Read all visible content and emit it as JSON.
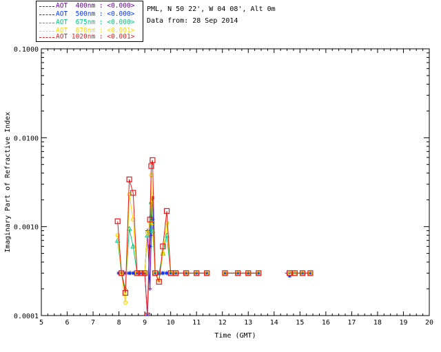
{
  "header": {
    "site": "PML, N 50 22', W 04 08', Alt 0m",
    "date": "Data from: 28 Sep 2014"
  },
  "chart_data": {
    "type": "line",
    "xlabel": "Time (GMT)",
    "ylabel": "Imaginary Part of Refractive Index",
    "xlim": [
      5,
      20
    ],
    "ylim": [
      0.0001,
      0.1
    ],
    "yscale": "log",
    "x_ticks": [
      "5",
      "6",
      "7",
      "8",
      "9",
      "10",
      "11",
      "12",
      "13",
      "14",
      "15",
      "16",
      "17",
      "18",
      "19",
      "20"
    ],
    "y_ticks": [
      "0.0001",
      "0.0010",
      "0.0100",
      "0.1000"
    ],
    "grid": false,
    "legend_position": "top-left",
    "series": [
      {
        "name": "AOT  400nm : <0.000>",
        "color": "#6a00a8",
        "marker": "plus",
        "x": [
          8.0,
          8.15,
          8.3,
          8.45,
          8.6,
          8.75,
          8.9,
          9.0,
          9.1,
          9.2,
          9.25,
          9.3,
          9.4,
          9.55,
          9.7,
          9.85,
          10.0,
          10.2,
          10.5,
          11.0,
          11.4,
          12.1,
          12.6,
          13.0,
          13.4,
          14.5,
          14.7,
          15.1,
          15.4
        ],
        "y": [
          0.0003,
          0.0003,
          0.0003,
          0.0003,
          0.0003,
          0.0003,
          0.0003,
          0.0003,
          0.0009,
          0.0002,
          0.0008,
          0.0012,
          0.0003,
          0.0003,
          0.0003,
          0.0003,
          0.0003,
          0.0003,
          0.0003,
          0.0003,
          0.0003,
          0.0003,
          0.0003,
          0.0003,
          0.0003,
          0.0003,
          0.0003,
          0.0003,
          0.0003
        ]
      },
      {
        "name": "AOT  500nm : <0.000>",
        "color": "#0033ff",
        "marker": "star",
        "x": [
          8.0,
          8.2,
          8.4,
          8.55,
          8.7,
          8.85,
          9.0,
          9.1,
          9.2,
          9.25,
          9.3,
          9.4,
          9.55,
          9.7,
          9.85,
          10.0,
          10.2,
          10.6,
          11.0,
          11.4,
          12.1,
          12.6,
          13.0,
          13.4,
          14.6,
          14.7,
          15.1,
          15.4
        ],
        "y": [
          0.0003,
          0.0003,
          0.0003,
          0.0003,
          0.0003,
          0.0003,
          0.0003,
          0.0001,
          0.0006,
          0.0013,
          0.0021,
          0.0003,
          0.0003,
          0.0003,
          0.0003,
          0.0003,
          0.0003,
          0.0003,
          0.0003,
          0.0003,
          0.0003,
          0.0003,
          0.0003,
          0.0003,
          0.00028,
          0.0003,
          0.0003,
          0.0003
        ]
      },
      {
        "name": "AOT  675nm : <0.000>",
        "color": "#00c87a",
        "marker": "triangle",
        "x": [
          7.95,
          8.1,
          8.25,
          8.4,
          8.55,
          8.7,
          8.85,
          9.0,
          9.1,
          9.2,
          9.25,
          9.3,
          9.4,
          9.55,
          9.7,
          9.85,
          10.0,
          10.2,
          10.6,
          11.0,
          11.4,
          12.1,
          12.6,
          13.0,
          13.4,
          14.6,
          14.8,
          15.1,
          15.4
        ],
        "y": [
          0.0007,
          0.0003,
          0.0002,
          0.00095,
          0.0006,
          0.0003,
          0.0003,
          0.0003,
          0.0008,
          0.0009,
          0.0019,
          0.0009,
          0.0003,
          0.0003,
          0.0005,
          0.0008,
          0.0003,
          0.0003,
          0.0003,
          0.0003,
          0.0003,
          0.0003,
          0.0003,
          0.0003,
          0.0003,
          0.0003,
          0.0003,
          0.0003,
          0.0003
        ]
      },
      {
        "name": "AOT  870nm : <0.001>",
        "color": "#ffd400",
        "marker": "circle",
        "x": [
          7.95,
          8.1,
          8.25,
          8.4,
          8.55,
          8.7,
          8.85,
          9.0,
          9.1,
          9.2,
          9.25,
          9.3,
          9.4,
          9.55,
          9.7,
          9.85,
          10.0,
          10.2,
          10.6,
          11.0,
          11.4,
          12.1,
          12.6,
          13.0,
          13.4,
          14.6,
          14.8,
          15.1,
          15.4
        ],
        "y": [
          0.0008,
          0.0003,
          0.00014,
          0.0023,
          0.0012,
          0.0003,
          0.0003,
          0.0003,
          0.00085,
          0.0011,
          0.0038,
          0.0011,
          0.0003,
          0.00025,
          0.0005,
          0.0011,
          0.0003,
          0.0003,
          0.0003,
          0.0003,
          0.0003,
          0.0003,
          0.0003,
          0.0003,
          0.0003,
          0.0003,
          0.0003,
          0.0003,
          0.0003
        ]
      },
      {
        "name": "AOT 1020nm : <0.001>",
        "color": "#e81818",
        "marker": "square",
        "x": [
          7.95,
          8.1,
          8.25,
          8.4,
          8.55,
          8.7,
          8.85,
          9.0,
          9.1,
          9.2,
          9.25,
          9.3,
          9.4,
          9.55,
          9.7,
          9.85,
          10.0,
          10.2,
          10.6,
          11.0,
          11.4,
          12.1,
          12.6,
          13.0,
          13.4,
          14.6,
          14.8,
          15.1,
          15.4
        ],
        "y": [
          0.00115,
          0.0003,
          0.00018,
          0.0034,
          0.0024,
          0.0003,
          0.0003,
          0.0003,
          0.0001,
          0.0012,
          0.0048,
          0.0056,
          0.0003,
          0.00024,
          0.0006,
          0.0015,
          0.0003,
          0.0003,
          0.0003,
          0.0003,
          0.0003,
          0.0003,
          0.0003,
          0.0003,
          0.0003,
          0.0003,
          0.0003,
          0.0003,
          0.0003
        ]
      }
    ]
  }
}
